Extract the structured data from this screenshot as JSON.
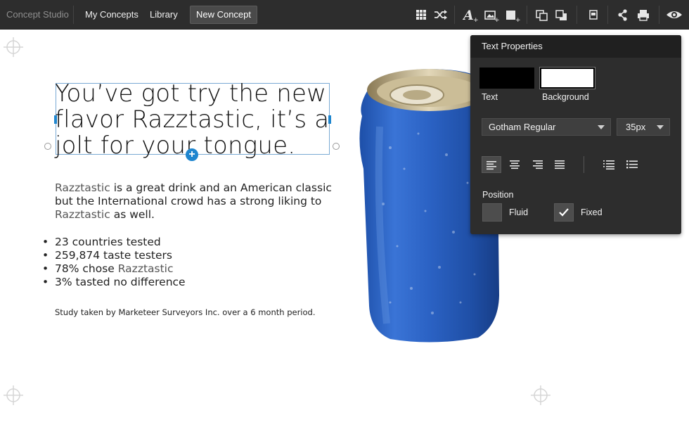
{
  "topbar": {
    "brand": "Concept Studio",
    "nav": [
      "My Concepts",
      "Library"
    ],
    "new_concept": "New Concept",
    "icons": [
      "grid-icon",
      "shuffle-icon",
      "text-add-icon",
      "image-add-icon",
      "shape-add-icon",
      "bring-forward-icon",
      "send-backward-icon",
      "page-icon",
      "share-icon",
      "print-icon",
      "preview-eye-icon"
    ]
  },
  "canvas": {
    "headline": "You’ve got try the new\nflavor Razztastic, it’s a\njolt for your tongue.",
    "body_part1": "Razztastic",
    "body_part2": " is a great drink and an American classic but the International crowd has a strong liking to ",
    "body_part3": "Razztastic",
    "body_part4": " as well.",
    "bullets": [
      {
        "text": "23 countries tested"
      },
      {
        "text": "259,874 taste testers"
      },
      {
        "text_pre": "78% chose ",
        "text_brand": "Razztastic"
      },
      {
        "text": "3% tasted no difference"
      }
    ],
    "footnote": "Study taken by Marketeer Surveyors Inc. over a 6 month period.",
    "image_name": "blue-soda-can"
  },
  "panel": {
    "title": "Text Properties",
    "text_color_label": "Text",
    "text_color": "#000000",
    "background_color_label": "Background",
    "background_color": "#ffffff",
    "font": "Gotham Regular",
    "size": "35px",
    "alignment_selected": "left",
    "position_label": "Position",
    "fluid_label": "Fluid",
    "fixed_label": "Fixed",
    "fluid_checked": false,
    "fixed_checked": true
  },
  "colors": {
    "topbar": "#2d2d2d",
    "panel": "#2d2d2d",
    "accent": "#1f86cf",
    "can_blue": "#2a5fc0"
  }
}
